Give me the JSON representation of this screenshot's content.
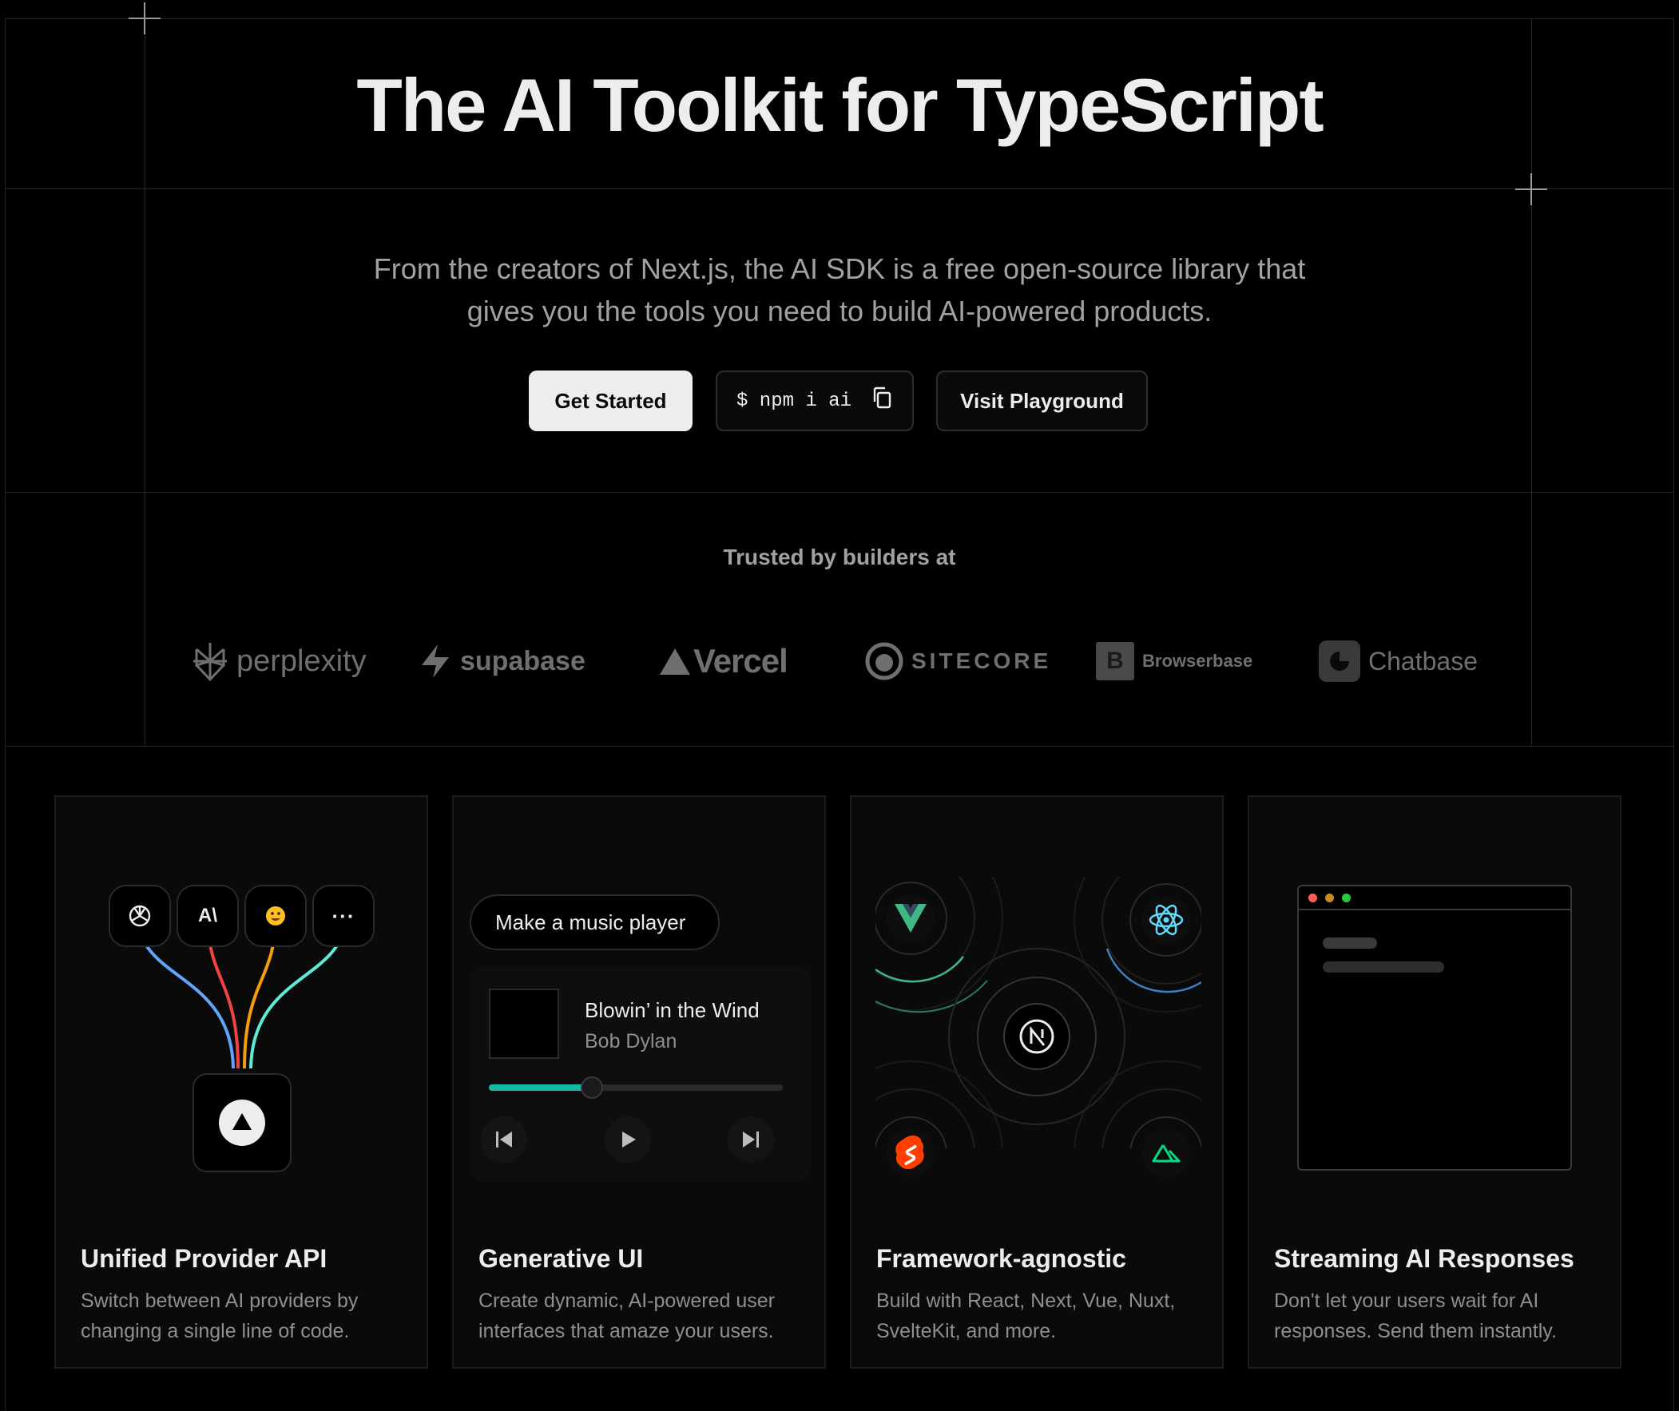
{
  "hero": {
    "title": "The AI Toolkit for TypeScript",
    "subtitle": "From the creators of Next.js, the AI SDK is a free open-source library that gives you the tools you need to build AI-powered products."
  },
  "actions": {
    "get_started": "Get Started",
    "npm_command": "$ npm i ai",
    "visit_playground": "Visit Playground"
  },
  "trusted": {
    "heading": "Trusted by builders at",
    "logos": [
      "perplexity",
      "supabase",
      "Vercel",
      "SITECORE",
      "Browserbase",
      "Chatbase"
    ]
  },
  "cards": [
    {
      "title": "Unified Provider API",
      "description": "Switch between AI providers by changing a single line of code."
    },
    {
      "title": "Generative UI",
      "description": "Create dynamic, AI-powered user interfaces that amaze your users."
    },
    {
      "title": "Framework-agnostic",
      "description": "Build with React, Next, Vue, Nuxt, SvelteKit, and more."
    },
    {
      "title": "Streaming AI Responses",
      "description": "Don't let your users wait for AI responses. Send them instantly."
    }
  ],
  "music_player": {
    "prompt": "Make a music player",
    "song": "Blowin’ in the Wind",
    "artist": "Bob Dylan",
    "progress": 0.35
  },
  "provider_icons": [
    "openai-icon",
    "anthropic-icon",
    "huggingface-icon",
    "more-icon"
  ],
  "colors": {
    "background": "#000000",
    "card": "#0a0a0a",
    "teal_progress": "#14b8a6",
    "vue_green": "#41b883",
    "react_blue": "#61dafb",
    "svelte_orange": "#ff3e00",
    "nuxt_green": "#00dc82",
    "traffic_red": "#ff5f56",
    "traffic_yellow": "#c98a1e",
    "traffic_green": "#27c93f"
  }
}
